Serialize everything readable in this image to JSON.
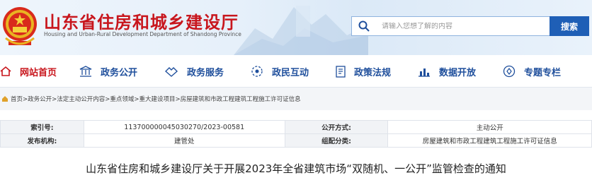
{
  "header": {
    "title": "山东省住房和城乡建设厅",
    "subtitle": "Housing and Urban-Rural Development Department of Shandong Province",
    "search_placeholder": "请输入您想了解的内容",
    "search_button": "搜索"
  },
  "nav": {
    "items": [
      {
        "label": "网站首页",
        "icon": "home-icon",
        "active": true
      },
      {
        "label": "政务公开",
        "icon": "building-icon"
      },
      {
        "label": "政务服务",
        "icon": "service-icon"
      },
      {
        "label": "政民互动",
        "icon": "interaction-icon"
      },
      {
        "label": "政策法规",
        "icon": "document-icon"
      },
      {
        "label": "数据开放",
        "icon": "chart-icon"
      },
      {
        "label": "专题专栏",
        "icon": "topic-icon"
      }
    ]
  },
  "breadcrumb": "首页>政务公开>法定主动公开内容>重点领域>重大建设项目>房屋建筑和市政工程建筑工程施工许可证信息",
  "info": {
    "index_label": "索引号:",
    "index_value": "113700000045030270/2023-00581",
    "method_label": "公开方式:",
    "method_value": "主动公开",
    "org_label": "发布机构:",
    "org_value": "建管处",
    "category_label": "组配分类:",
    "category_value": "房屋建筑和市政工程建筑工程施工许可证信息"
  },
  "article": {
    "title": "山东省住房和城乡建设厅关于开展2023年全省建筑市场“双随机、一公开”监管检查的通知"
  },
  "colors": {
    "brand_red": "#c8161d",
    "nav_blue": "#1f4f9c",
    "search_blue": "#1f5fb6"
  }
}
